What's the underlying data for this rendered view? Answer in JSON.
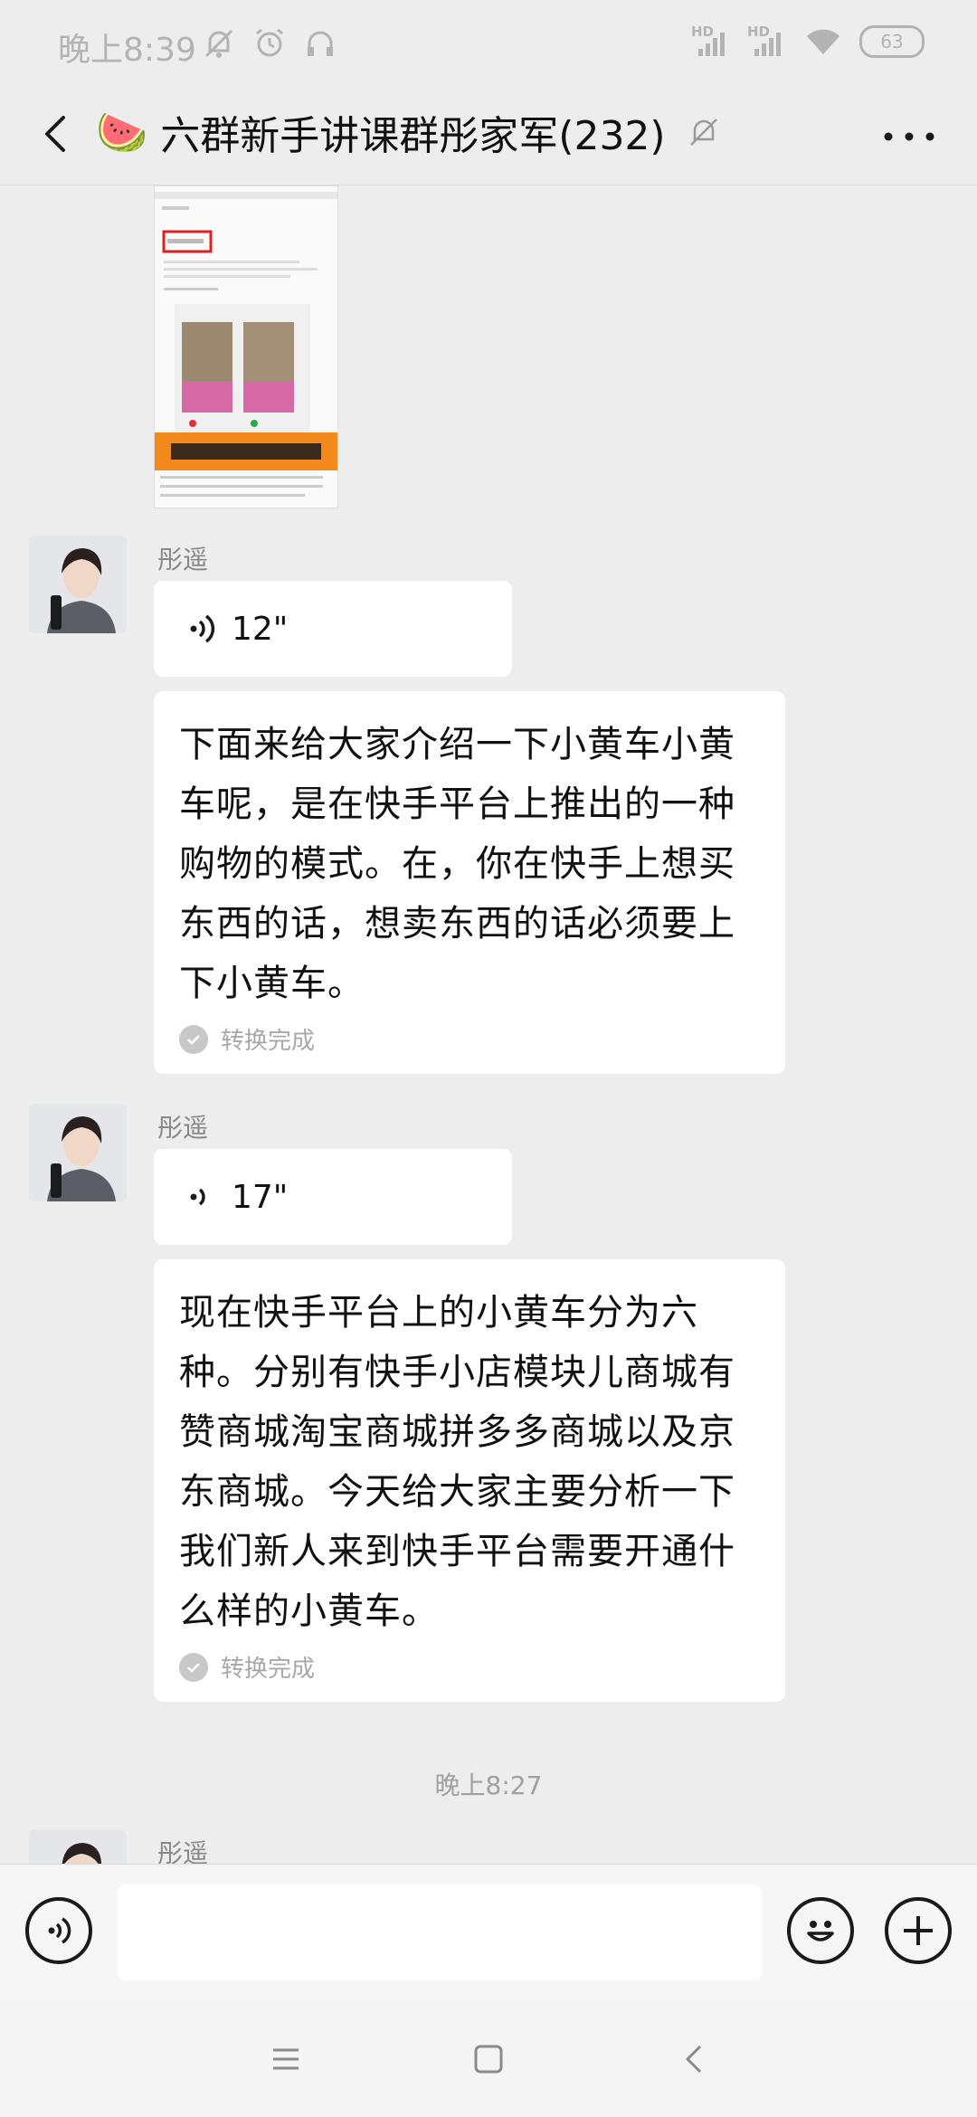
{
  "status_bar": {
    "time": "晚上8:39",
    "network_1": "HD",
    "network_2": "HD",
    "battery": "63"
  },
  "header": {
    "group_emoji": "🍉",
    "title": "六群新手讲课群彤家军(232)"
  },
  "chat": {
    "messages": [
      {
        "sender": "彤遥",
        "voice_duration": "12\"",
        "transcript": "下面来给大家介绍一下小黄车小黄车呢，是在快手平台上推出的一种购物的模式。在，你在快手上想买东西的话，想卖东西的话必须要上下小黄车。",
        "status": "转换完成"
      },
      {
        "sender": "彤遥",
        "voice_duration": "17\"",
        "transcript": "现在快手平台上的小黄车分为六种。分别有快手小店模块儿商城有赞商城淘宝商城拼多多商城以及京东商城。今天给大家主要分析一下我们新人来到快手平台需要开通什么样的小黄车。",
        "status": "转换完成"
      }
    ],
    "timestamp": "晚上8:27",
    "next_sender": "彤遥"
  },
  "input": {
    "placeholder": ""
  },
  "colors": {
    "background": "#ededed",
    "bubble": "#ffffff",
    "muted_text": "#888888"
  }
}
